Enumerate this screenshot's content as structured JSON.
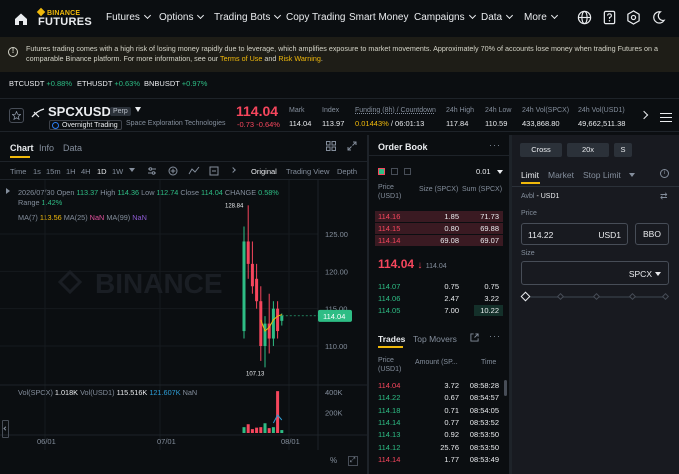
{
  "nav": {
    "logo_top": "BINANCE",
    "logo_bottom": "FUTURES",
    "items": [
      "Futures",
      "Options",
      "Trading Bots",
      "Copy Trading",
      "Smart Money",
      "Campaigns",
      "Data",
      "More"
    ]
  },
  "warning": {
    "text_before": "Futures trading comes with a high risk of losing money rapidly due to leverage, which amplifies exposure to market movements. Approximately 70% of accounts lose money when trading Futures on a comparable Binance platform. For more information, see our ",
    "link1": "Terms of Use",
    "middle": " and ",
    "link2": "Risk Warning",
    "end": "."
  },
  "tickers": [
    {
      "symbol": "BTCUSDT",
      "change": "+0.88%"
    },
    {
      "symbol": "ETHUSDT",
      "change": "+0.63%"
    },
    {
      "symbol": "BNBUSDT",
      "change": "+0.97%"
    }
  ],
  "symbol": {
    "name": "SPCXUSD1",
    "badge": "Perp",
    "tag": "Overnight Trading",
    "company": "Space Exploration Technologies",
    "price": "114.04",
    "change": "-0.73",
    "change_pct": "-0.64%",
    "stats": [
      {
        "label": "Mark",
        "value": "114.04"
      },
      {
        "label": "Index",
        "value": "113.97"
      },
      {
        "label": "Funding (8h) / Countdown",
        "value": "0.01443%",
        "value2": "/ 06:01:13"
      },
      {
        "label": "24h High",
        "value": "117.84"
      },
      {
        "label": "24h Low",
        "value": "110.59"
      },
      {
        "label": "24h Vol(SPCX)",
        "value": "433,868.80"
      },
      {
        "label": "24h Vol(USD1)",
        "value": "49,662,511.38"
      }
    ]
  },
  "chart": {
    "tabs": [
      "Chart",
      "Info",
      "Data"
    ],
    "intervals": [
      "Time",
      "1s",
      "15m",
      "1H",
      "4H",
      "1D",
      "1W"
    ],
    "views": [
      "Original",
      "Trading View",
      "Depth"
    ],
    "ohlc": {
      "date": "2026/07/30",
      "open_l": "Open",
      "open": "113.37",
      "high_l": "High",
      "high": "114.36",
      "low_l": "Low",
      "low": "112.74",
      "close_l": "Close",
      "close": "114.04",
      "change_l": "CHANGE",
      "change": "0.58%",
      "range_l": "Range",
      "range": "1.42%"
    },
    "ma": {
      "ma7_l": "MA(7)",
      "ma7": "113.56",
      "ma25_l": "MA(25)",
      "ma25": "NaN",
      "ma99_l": "MA(99)",
      "ma99": "NaN"
    },
    "vol": {
      "l": "Vol(SPCX)",
      "v1": "1.018K",
      "l2": "Vol(USD1)",
      "v2": "115.516K",
      "v3": "121.607K",
      "v4": "NaN"
    },
    "watermark": "BINANCE",
    "price_labels": [
      "125.00",
      "120.00",
      "115.00",
      "110.00"
    ],
    "current_tag": "114.04",
    "high_marker": "128.84",
    "low_marker": "107.13",
    "vol_labels": [
      "400K",
      "200K"
    ],
    "x_labels": [
      "06/01",
      "07/01",
      "08/01"
    ],
    "candles": [
      {
        "o": 112,
        "h": 126,
        "l": 111,
        "c": 124
      },
      {
        "o": 124,
        "h": 128.84,
        "l": 119,
        "c": 121
      },
      {
        "o": 121,
        "h": 124,
        "l": 117,
        "c": 118
      },
      {
        "o": 119,
        "h": 121,
        "l": 115,
        "c": 116
      },
      {
        "o": 116,
        "h": 118,
        "l": 108,
        "c": 110
      },
      {
        "o": 110,
        "h": 114,
        "l": 107.13,
        "c": 113
      },
      {
        "o": 113,
        "h": 117,
        "l": 109,
        "c": 111
      },
      {
        "o": 111,
        "h": 116,
        "l": 110,
        "c": 115
      },
      {
        "o": 115,
        "h": 116,
        "l": 111,
        "c": 112
      },
      {
        "o": 113.37,
        "h": 114.36,
        "l": 112.74,
        "c": 114.04
      }
    ],
    "volumes": [
      60,
      90,
      40,
      55,
      60,
      100,
      50,
      60,
      430,
      30
    ]
  },
  "orderbook": {
    "title": "Order Book",
    "step": "0.01",
    "h_price": "Price (USD1)",
    "h_size": "Size (SPCX)",
    "h_sum": "Sum (SPCX)",
    "asks": [
      {
        "p": "114.16",
        "s": "1.85",
        "t": "71.73"
      },
      {
        "p": "114.15",
        "s": "0.80",
        "t": "69.88"
      },
      {
        "p": "114.14",
        "s": "69.08",
        "t": "69.07"
      }
    ],
    "mid": "114.04",
    "mid_sub": "114.04",
    "bids": [
      {
        "p": "114.07",
        "s": "0.75",
        "t": "0.75"
      },
      {
        "p": "114.06",
        "s": "2.47",
        "t": "3.22"
      },
      {
        "p": "114.05",
        "s": "7.00",
        "t": "10.22"
      }
    ]
  },
  "trades": {
    "tab1": "Trades",
    "tab2": "Top Movers",
    "h_price": "Price (USD1)",
    "h_amount": "Amount (SP...",
    "h_time": "Time",
    "rows": [
      {
        "p": "114.04",
        "a": "3.72",
        "t": "08:58:28",
        "side": "sell"
      },
      {
        "p": "114.22",
        "a": "0.67",
        "t": "08:54:57",
        "side": "buy"
      },
      {
        "p": "114.18",
        "a": "0.71",
        "t": "08:54:05",
        "side": "buy"
      },
      {
        "p": "114.14",
        "a": "0.77",
        "t": "08:53:52",
        "side": "buy"
      },
      {
        "p": "114.13",
        "a": "0.92",
        "t": "08:53:50",
        "side": "buy"
      },
      {
        "p": "114.12",
        "a": "25.76",
        "t": "08:53:50",
        "side": "buy"
      },
      {
        "p": "114.14",
        "a": "1.77",
        "t": "08:53:49",
        "side": "sell"
      }
    ]
  },
  "form": {
    "margin": "Cross",
    "leverage": "20x",
    "mode": "S",
    "types": [
      "Limit",
      "Market",
      "Stop Limit"
    ],
    "avbl_l": "Avbl",
    "avbl": "- USD1",
    "price_l": "Price",
    "price": "114.22",
    "price_unit": "USD1",
    "bbo": "BBO",
    "size_l": "Size",
    "size_unit": "SPCX"
  },
  "colors": {
    "up": "#2ebd85",
    "down": "#f6465d",
    "accent": "#f0b90b"
  }
}
